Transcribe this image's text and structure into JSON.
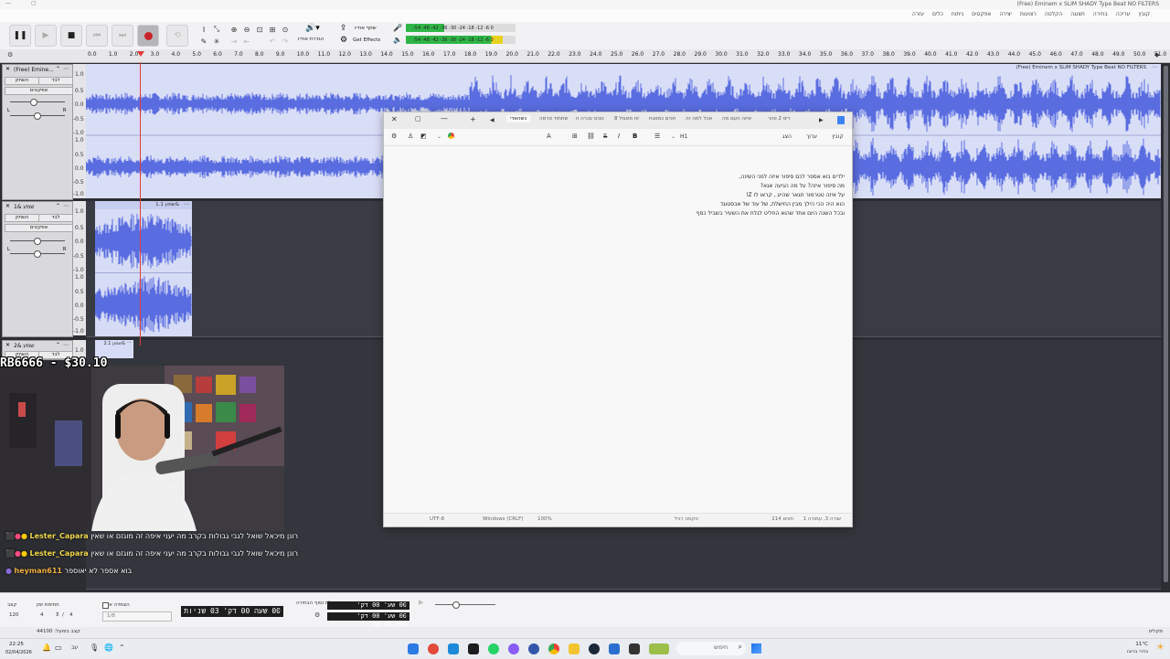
{
  "window": {
    "title": "(Free) Eminem x SLIM SHADY Type Beat  NO FILTERS"
  },
  "menu": {
    "items": [
      "קובץ",
      "עריכה",
      "בחירה",
      "תצוגה",
      "הקלטה",
      "רצועות",
      "יצירה",
      "אפקטים",
      "ניתוח",
      "כלים",
      "עזרה"
    ]
  },
  "toolbar": {
    "share_audio_label": "שתף אודיו",
    "audio_setup_label": "הגדרת אודיו",
    "get_effects_label": "Get Effects",
    "meter_scale_record": "-54 -48 -42 -36 -30 -24 -18 -12 -6 0",
    "meter_scale_play": "-54 -48 -42 -36 -30 -24 -18 -12 -6 0"
  },
  "ruler": {
    "ticks": [
      "0.0",
      "1.0",
      "2.0",
      "3.0",
      "4.0",
      "5.0",
      "6.0",
      "7.0",
      "8.0",
      "9.0",
      "10.0",
      "11.0",
      "12.0",
      "13.0",
      "14.0",
      "15.0",
      "16.0",
      "17.0",
      "18.0",
      "19.0",
      "20.0",
      "21.0",
      "22.0",
      "23.0",
      "24.0",
      "25.0",
      "26.0",
      "27.0",
      "28.0",
      "29.0",
      "30.0",
      "31.0",
      "32.0",
      "33.0",
      "34.0",
      "35.0",
      "36.0",
      "37.0",
      "38.0",
      "39.0",
      "40.0",
      "41.0",
      "42.0",
      "43.0",
      "44.0",
      "45.0",
      "46.0",
      "47.0",
      "48.0",
      "49.0",
      "50.0",
      "51.0"
    ],
    "playhead_position_seconds": 2.5
  },
  "tracks": [
    {
      "name": "(Free) Emine...",
      "clip_title": "(Free) Eminem x SLIM SHADY Type Beat  NO FILTERS",
      "mute_label": "השתק",
      "solo_label": "לבד",
      "effects_label": "אפקטים",
      "scale": [
        "1.0",
        "0.5",
        "0.0",
        "-0.5",
        "-1.0",
        "1.0",
        "0.5",
        "0.0",
        "-0.5",
        "-1.0"
      ]
    },
    {
      "name": "שמע &1",
      "clip_title": "שמע 1.1&",
      "mute_label": "השתק",
      "solo_label": "לבד",
      "effects_label": "אפקטים",
      "scale": [
        "1.0",
        "0.5",
        "0.0",
        "-0.5",
        "-1.0",
        "1.0",
        "0.5",
        "0.0",
        "-0.5",
        "-1.0"
      ]
    },
    {
      "name": "שמע &2",
      "clip_title": "שמע 2.1&",
      "mute_label": "השתק",
      "solo_label": "לבד",
      "scale": [
        "1.0"
      ]
    }
  ],
  "notepad": {
    "tabs": [
      "ריס 2 ווהר",
      "איזה העם מה",
      "אכל למה זה",
      "חכים כמאגח",
      "זוז מאגזל 8",
      "טגים עכרה זו",
      "שתחוד טרמה",
      "כשהאדי"
    ],
    "menu": [
      "קובץ",
      "ערוך",
      "הצג"
    ],
    "format_h1": "H1",
    "lines": [
      "ילדים בוא אספר לכם סיפור איזה לפני השינה,",
      "מה סיפור איזה? על מה הגיעה אגא?",
      "על איזה טטרמור חגאר שהיע , קראו לו Z!",
      "הוא היה הכי הילך מבין החישלת, של עוד של אבסטוגד",
      "ובכל השנה היום אתד שהוא החליט לגלח את השעיר בשביל כסף"
    ],
    "status": {
      "position": "שורה 3, עמודה 1",
      "chars": "214 תווים",
      "type": "טקסט רגיל",
      "zoom": "100%",
      "eol": "Windows (CRLF)",
      "encoding": "UTF-8"
    }
  },
  "stream": {
    "donation_overlay": "RB6666 - $30.10",
    "chat": [
      {
        "user": "Lester_Capara",
        "text": "רונן מיכאל שואל לגבי גבולות בקרב מה יעני איפה זה מוגזם או שאין"
      },
      {
        "user": "Lester_Capara",
        "text": "רונן מיכאל שואל לגבי גבולות בקרב מה יעני איפה זה מוגזם או שאין"
      },
      {
        "user": "heyman611",
        "text": "בוא אספר לא יאוספר"
      }
    ]
  },
  "bottom": {
    "project_rate_label": "קצב",
    "project_rate_value": "120",
    "time_signature_label": "חתימת זמן",
    "time_sig_num": "4",
    "time_sig_den": "4",
    "snap_label": "הצמדה אל",
    "snap_value": "1/8",
    "time_display": "00 שעה 00 דק' 03 שניות",
    "selection_label": "תחילת וסוף הבחירה",
    "selection_start": "00 שע' 00 דק' 00.000 שנ'",
    "selection_end": "00 שע' 00 דק' 00.000 שנ'",
    "status_left": "קצב בפועל: 44100",
    "status_right": "מקליט"
  },
  "taskbar": {
    "time": "22:25",
    "date": "02/04/2026",
    "search_placeholder": "חיפוש",
    "weather": "11°C",
    "weather_desc": "בהיר ברובו"
  }
}
